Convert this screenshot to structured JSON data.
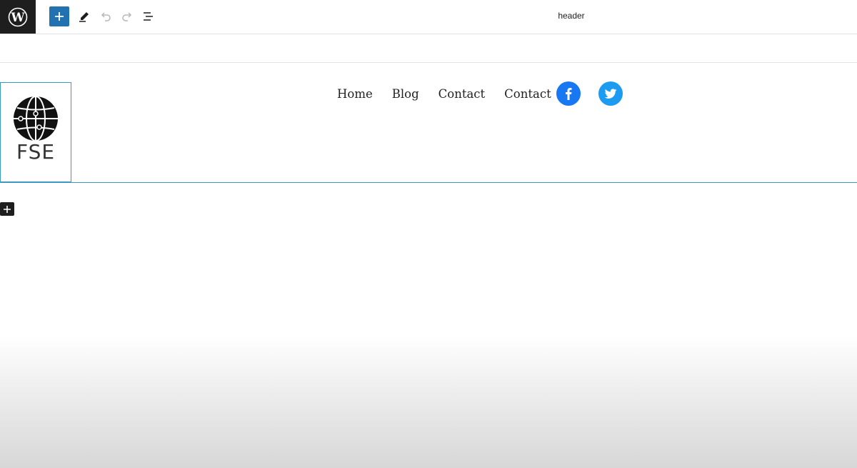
{
  "toolbar": {
    "wordpress_icon": "wordpress-logo-icon",
    "add_block_icon": "plus-icon",
    "tools_icon": "pencil-icon",
    "undo_icon": "undo-icon",
    "redo_icon": "redo-icon",
    "list_view_icon": "list-view-icon",
    "document_title": "header",
    "accent_color": "#2271b1"
  },
  "header_template": {
    "logo": {
      "icon": "globe-icon",
      "text": "FSE"
    },
    "navigation": [
      {
        "label": "Home"
      },
      {
        "label": "Blog"
      },
      {
        "label": "Contact"
      },
      {
        "label": "Contact"
      }
    ],
    "social_links": [
      {
        "icon": "facebook-icon",
        "color": "#1877f2"
      },
      {
        "icon": "twitter-icon",
        "color": "#1d9bf0"
      }
    ],
    "selection_color": "#3b9bbf"
  },
  "block_inserter": {
    "icon": "plus-icon"
  }
}
